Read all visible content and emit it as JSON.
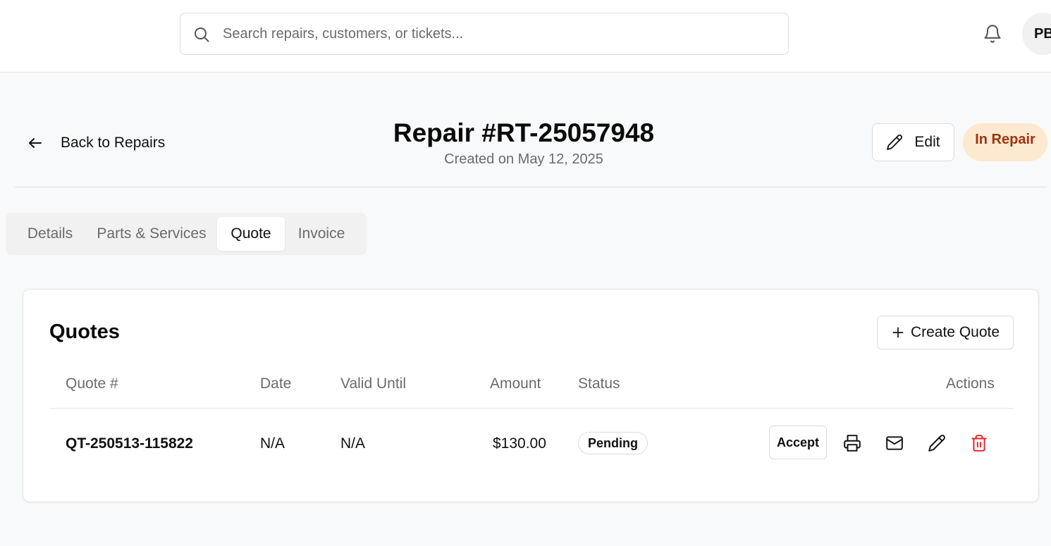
{
  "header": {
    "search_placeholder": "Search repairs, customers, or tickets...",
    "search_value": "",
    "avatar_initials": "PB"
  },
  "page": {
    "back_label": "Back to Repairs",
    "title": "Repair #RT-25057948",
    "subtitle": "Created on May 12, 2025",
    "edit_label": "Edit",
    "status_label": "In Repair"
  },
  "tabs": [
    {
      "label": "Details",
      "active": false
    },
    {
      "label": "Parts & Services",
      "active": false
    },
    {
      "label": "Quote",
      "active": true
    },
    {
      "label": "Invoice",
      "active": false
    }
  ],
  "quotes": {
    "title": "Quotes",
    "create_label": "Create Quote",
    "columns": [
      "Quote #",
      "Date",
      "Valid Until",
      "Amount",
      "Status",
      "Actions"
    ],
    "rows": [
      {
        "quote_number": "QT-250513-115822",
        "date": "N/A",
        "valid_until": "N/A",
        "amount": "$130.00",
        "status": "Pending",
        "accept_label": "Accept"
      }
    ]
  },
  "icons": {
    "search": "search-icon",
    "bell": "bell-icon",
    "back": "arrow-left-icon",
    "edit": "pencil-icon",
    "create": "plus-icon",
    "print": "printer-icon",
    "email": "mail-icon",
    "row_edit": "pencil-icon",
    "delete": "trash-icon"
  },
  "colors": {
    "status_pill_bg": "#fde9cf",
    "status_pill_text": "#9a3412",
    "delete_icon": "#dc2626"
  }
}
